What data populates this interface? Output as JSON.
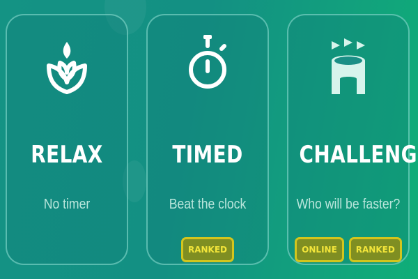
{
  "modes": [
    {
      "title": "RELAX",
      "subtitle": "No timer",
      "icon": "leaf-icon",
      "badges": []
    },
    {
      "title": "TIMED",
      "subtitle": "Beat the clock",
      "icon": "stopwatch-icon",
      "badges": [
        "RANKED"
      ]
    },
    {
      "title": "CHALLENGE",
      "subtitle": "Who will be faster?",
      "icon": "arena-icon",
      "badges": [
        "ONLINE",
        "RANKED"
      ]
    }
  ],
  "colors": {
    "background": "#139083",
    "card_border": "#96e6d7",
    "badge_border": "#d3c51d",
    "badge_text": "#f3e53a",
    "subtitle_text": "#b9e6dc"
  }
}
